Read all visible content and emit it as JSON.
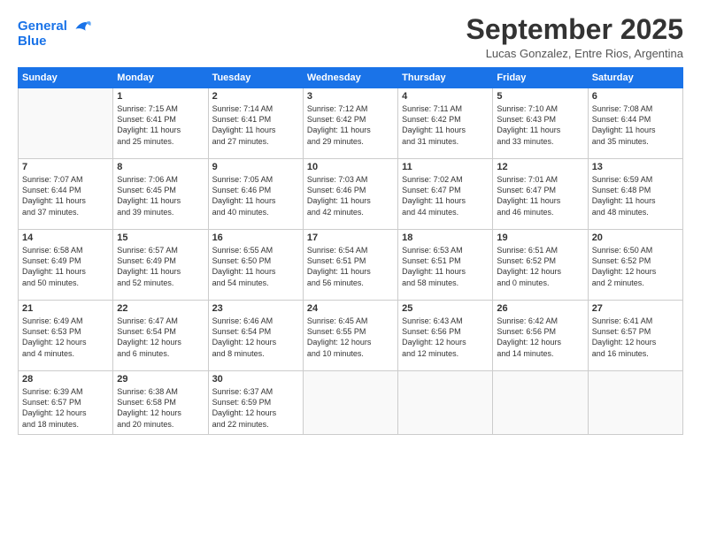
{
  "header": {
    "logo_line1": "General",
    "logo_line2": "Blue",
    "month": "September 2025",
    "location": "Lucas Gonzalez, Entre Rios, Argentina"
  },
  "weekdays": [
    "Sunday",
    "Monday",
    "Tuesday",
    "Wednesday",
    "Thursday",
    "Friday",
    "Saturday"
  ],
  "weeks": [
    [
      {
        "day": "",
        "text": ""
      },
      {
        "day": "1",
        "text": "Sunrise: 7:15 AM\nSunset: 6:41 PM\nDaylight: 11 hours\nand 25 minutes."
      },
      {
        "day": "2",
        "text": "Sunrise: 7:14 AM\nSunset: 6:41 PM\nDaylight: 11 hours\nand 27 minutes."
      },
      {
        "day": "3",
        "text": "Sunrise: 7:12 AM\nSunset: 6:42 PM\nDaylight: 11 hours\nand 29 minutes."
      },
      {
        "day": "4",
        "text": "Sunrise: 7:11 AM\nSunset: 6:42 PM\nDaylight: 11 hours\nand 31 minutes."
      },
      {
        "day": "5",
        "text": "Sunrise: 7:10 AM\nSunset: 6:43 PM\nDaylight: 11 hours\nand 33 minutes."
      },
      {
        "day": "6",
        "text": "Sunrise: 7:08 AM\nSunset: 6:44 PM\nDaylight: 11 hours\nand 35 minutes."
      }
    ],
    [
      {
        "day": "7",
        "text": "Sunrise: 7:07 AM\nSunset: 6:44 PM\nDaylight: 11 hours\nand 37 minutes."
      },
      {
        "day": "8",
        "text": "Sunrise: 7:06 AM\nSunset: 6:45 PM\nDaylight: 11 hours\nand 39 minutes."
      },
      {
        "day": "9",
        "text": "Sunrise: 7:05 AM\nSunset: 6:46 PM\nDaylight: 11 hours\nand 40 minutes."
      },
      {
        "day": "10",
        "text": "Sunrise: 7:03 AM\nSunset: 6:46 PM\nDaylight: 11 hours\nand 42 minutes."
      },
      {
        "day": "11",
        "text": "Sunrise: 7:02 AM\nSunset: 6:47 PM\nDaylight: 11 hours\nand 44 minutes."
      },
      {
        "day": "12",
        "text": "Sunrise: 7:01 AM\nSunset: 6:47 PM\nDaylight: 11 hours\nand 46 minutes."
      },
      {
        "day": "13",
        "text": "Sunrise: 6:59 AM\nSunset: 6:48 PM\nDaylight: 11 hours\nand 48 minutes."
      }
    ],
    [
      {
        "day": "14",
        "text": "Sunrise: 6:58 AM\nSunset: 6:49 PM\nDaylight: 11 hours\nand 50 minutes."
      },
      {
        "day": "15",
        "text": "Sunrise: 6:57 AM\nSunset: 6:49 PM\nDaylight: 11 hours\nand 52 minutes."
      },
      {
        "day": "16",
        "text": "Sunrise: 6:55 AM\nSunset: 6:50 PM\nDaylight: 11 hours\nand 54 minutes."
      },
      {
        "day": "17",
        "text": "Sunrise: 6:54 AM\nSunset: 6:51 PM\nDaylight: 11 hours\nand 56 minutes."
      },
      {
        "day": "18",
        "text": "Sunrise: 6:53 AM\nSunset: 6:51 PM\nDaylight: 11 hours\nand 58 minutes."
      },
      {
        "day": "19",
        "text": "Sunrise: 6:51 AM\nSunset: 6:52 PM\nDaylight: 12 hours\nand 0 minutes."
      },
      {
        "day": "20",
        "text": "Sunrise: 6:50 AM\nSunset: 6:52 PM\nDaylight: 12 hours\nand 2 minutes."
      }
    ],
    [
      {
        "day": "21",
        "text": "Sunrise: 6:49 AM\nSunset: 6:53 PM\nDaylight: 12 hours\nand 4 minutes."
      },
      {
        "day": "22",
        "text": "Sunrise: 6:47 AM\nSunset: 6:54 PM\nDaylight: 12 hours\nand 6 minutes."
      },
      {
        "day": "23",
        "text": "Sunrise: 6:46 AM\nSunset: 6:54 PM\nDaylight: 12 hours\nand 8 minutes."
      },
      {
        "day": "24",
        "text": "Sunrise: 6:45 AM\nSunset: 6:55 PM\nDaylight: 12 hours\nand 10 minutes."
      },
      {
        "day": "25",
        "text": "Sunrise: 6:43 AM\nSunset: 6:56 PM\nDaylight: 12 hours\nand 12 minutes."
      },
      {
        "day": "26",
        "text": "Sunrise: 6:42 AM\nSunset: 6:56 PM\nDaylight: 12 hours\nand 14 minutes."
      },
      {
        "day": "27",
        "text": "Sunrise: 6:41 AM\nSunset: 6:57 PM\nDaylight: 12 hours\nand 16 minutes."
      }
    ],
    [
      {
        "day": "28",
        "text": "Sunrise: 6:39 AM\nSunset: 6:57 PM\nDaylight: 12 hours\nand 18 minutes."
      },
      {
        "day": "29",
        "text": "Sunrise: 6:38 AM\nSunset: 6:58 PM\nDaylight: 12 hours\nand 20 minutes."
      },
      {
        "day": "30",
        "text": "Sunrise: 6:37 AM\nSunset: 6:59 PM\nDaylight: 12 hours\nand 22 minutes."
      },
      {
        "day": "",
        "text": ""
      },
      {
        "day": "",
        "text": ""
      },
      {
        "day": "",
        "text": ""
      },
      {
        "day": "",
        "text": ""
      }
    ]
  ]
}
